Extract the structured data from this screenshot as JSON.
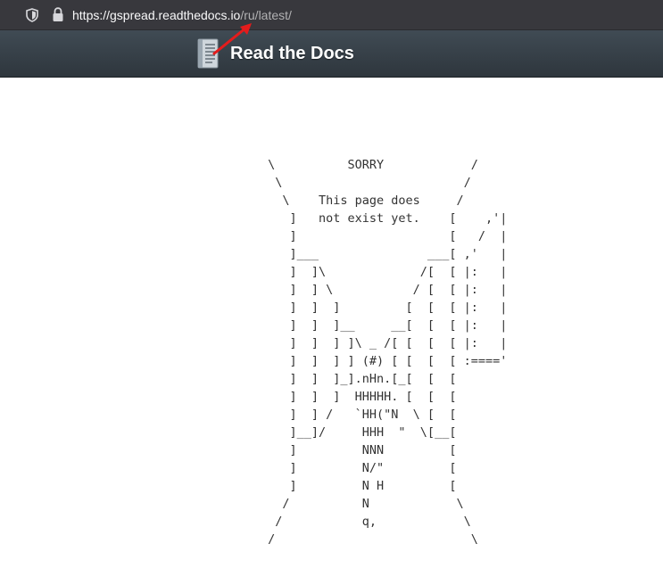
{
  "browser": {
    "url_host": "https://gspread.readthedocs.io",
    "url_path": "/ru/latest/",
    "icons": [
      "shield-icon",
      "lock-icon"
    ]
  },
  "header": {
    "title": "Read the Docs",
    "logo_icon": "document-book-icon",
    "background": "#343d45"
  },
  "annotation": {
    "arrow_color": "#e51c1c"
  },
  "error_page": {
    "ascii_art": " \\          SORRY            /\n  \\                         /\n   \\    This page does     /\n    ]   not exist yet.    [    ,'|\n    ]                     [   /  |\n    ]___               ___[ ,'   |\n    ]  ]\\             /[  [ |:   |\n    ]  ] \\           / [  [ |:   |\n    ]  ]  ]         [  [  [ |:   |\n    ]  ]  ]__     __[  [  [ |:   |\n    ]  ]  ] ]\\ _ /[ [  [  [ |:   |\n    ]  ]  ] ] (#) [ [  [  [ :====' \n    ]  ]  ]_].nHn.[_[  [  [\n    ]  ]  ]  HHHHH. [  [  [\n    ]  ] /   `HH(\"N  \\ [  [\n    ]__]/     HHH  \"  \\[__[\n    ]         NNN         [\n    ]         N/\"         [\n    ]         N H         [\n   /          N            \\\n  /           q,            \\\n /                           \\"
  }
}
